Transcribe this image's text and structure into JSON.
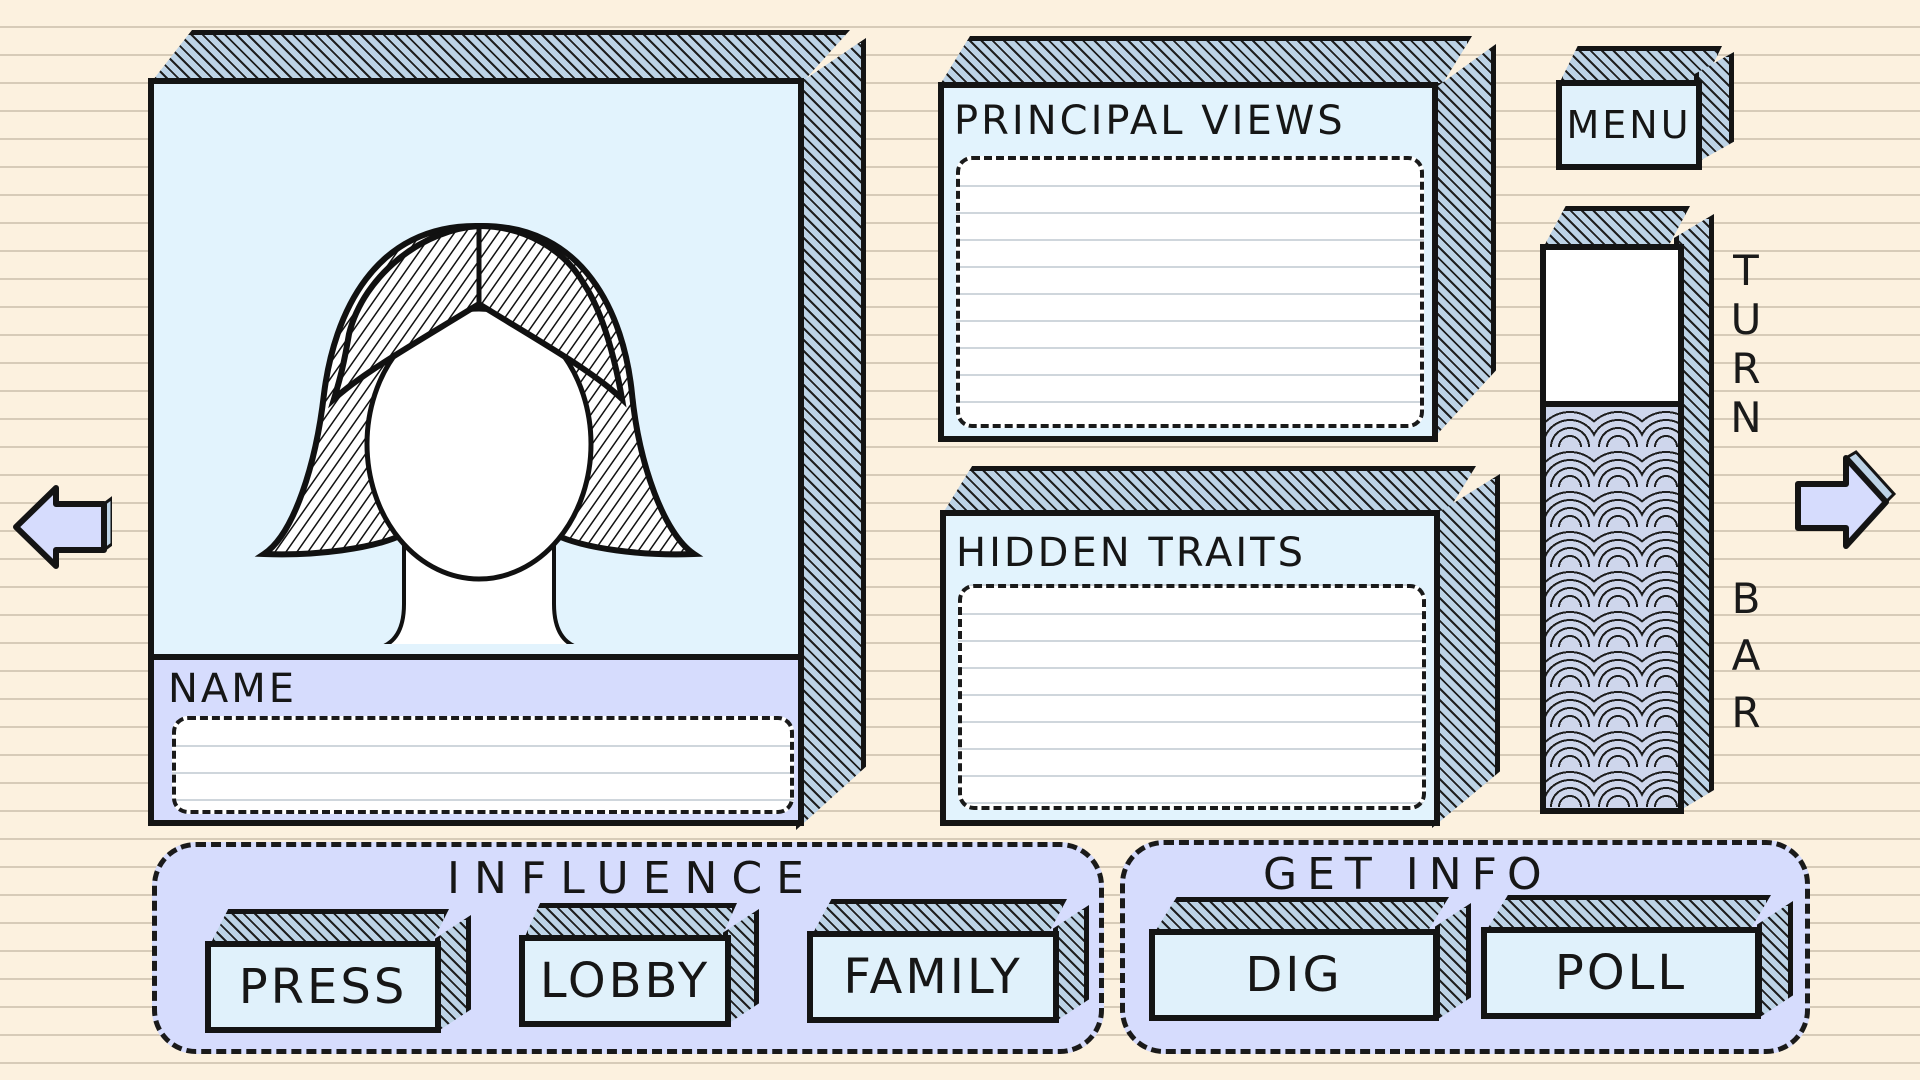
{
  "character": {
    "name_label": "NAME",
    "name_value": ""
  },
  "panels": {
    "principal_views": {
      "title": "PRINCIPAL VIEWS"
    },
    "hidden_traits": {
      "title": "HIDDEN TRAITS"
    }
  },
  "menu": {
    "label": "MENU"
  },
  "turn_bar": {
    "label_top": [
      "T",
      "U",
      "R",
      "N"
    ],
    "label_bottom": [
      "B",
      "A",
      "R"
    ],
    "fill_fraction": 0.73
  },
  "influence": {
    "title": "INFLUENCE",
    "buttons": [
      "PRESS",
      "LOBBY",
      "FAMILY"
    ]
  },
  "get_info": {
    "title": "GET INFO",
    "buttons": [
      "DIG",
      "POLL"
    ]
  },
  "navigation": {
    "prev_icon": "left-arrow",
    "next_icon": "right-arrow"
  },
  "colors": {
    "paper": "#fcf1df",
    "panel_face": "#e2f3fd",
    "panel_side": "#bdd3e6",
    "group_bg": "#d6dcfd",
    "name_strip": "#d6dcfd",
    "ink": "#141414"
  }
}
